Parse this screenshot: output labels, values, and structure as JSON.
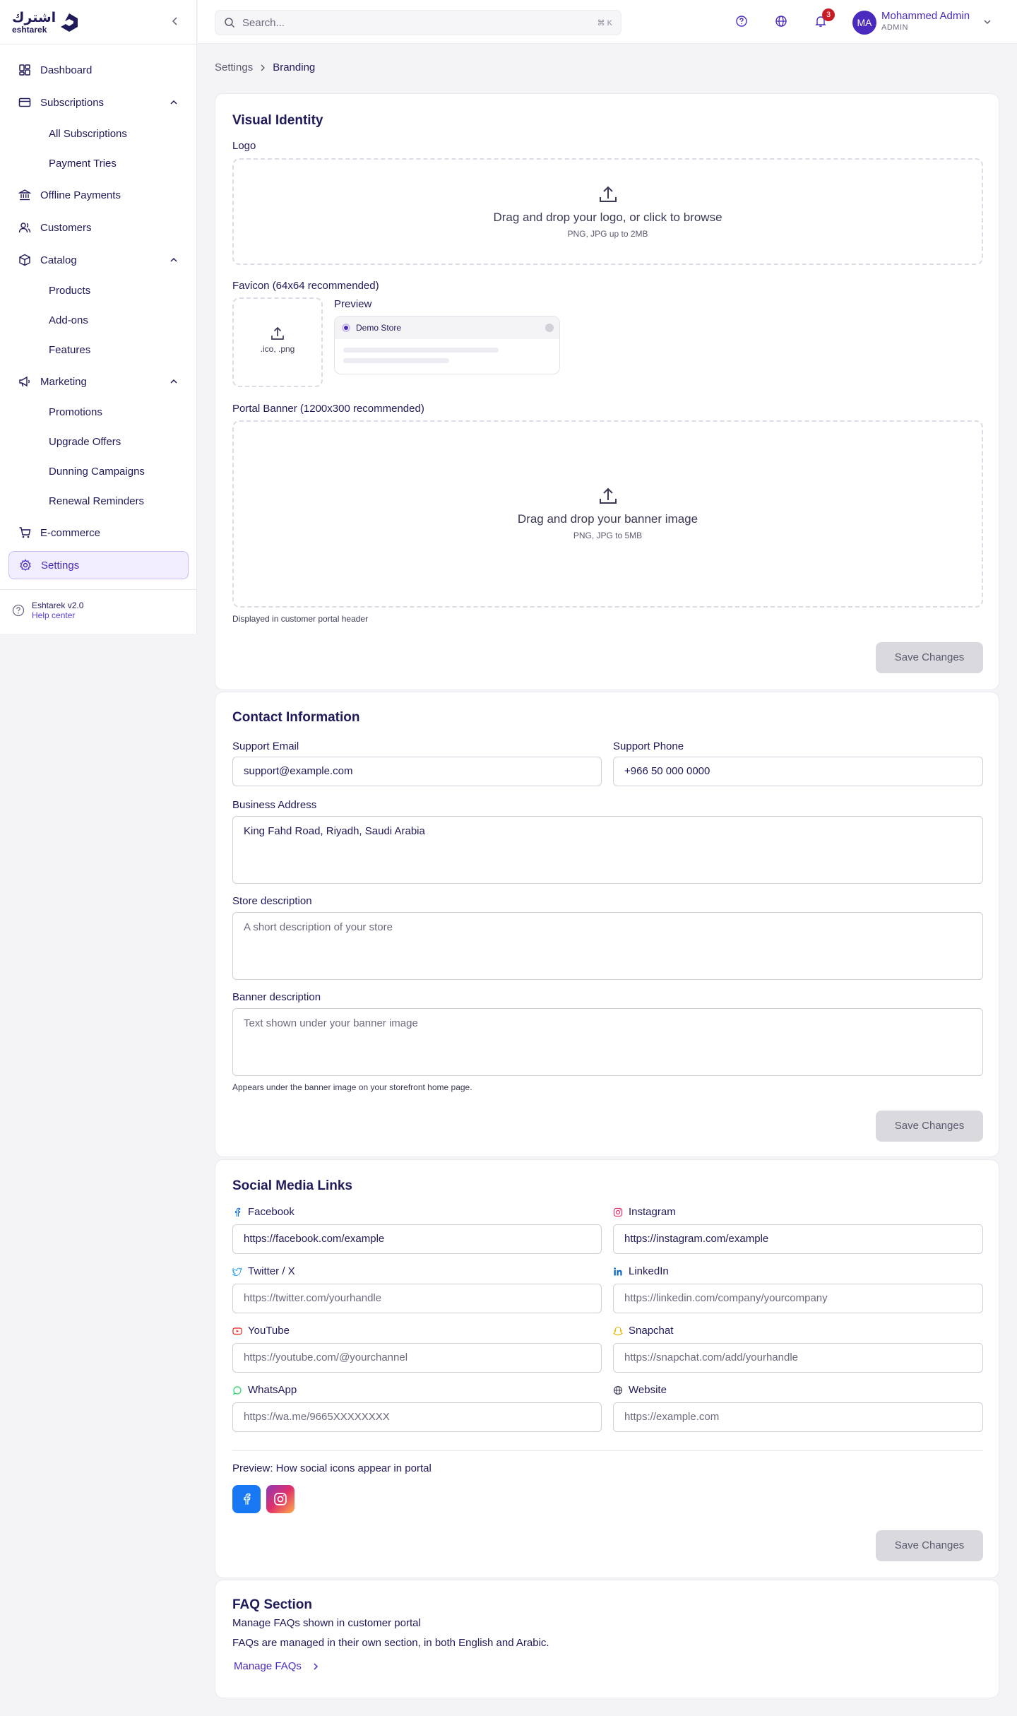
{
  "brand": {
    "name_ar": "اشترك",
    "name_en": "eshtarek"
  },
  "sidebar": {
    "items": [
      {
        "label": "Dashboard"
      },
      {
        "label": "Subscriptions"
      },
      {
        "label": "Offline Payments"
      },
      {
        "label": "Customers"
      },
      {
        "label": "Catalog"
      },
      {
        "label": "Marketing"
      },
      {
        "label": "E-commerce"
      },
      {
        "label": "Settings"
      }
    ],
    "subscriptions_sub": [
      "All Subscriptions",
      "Payment Tries"
    ],
    "catalog_sub": [
      "Products",
      "Add-ons",
      "Features"
    ],
    "marketing_sub": [
      "Promotions",
      "Upgrade Offers",
      "Dunning Campaigns",
      "Renewal Reminders"
    ],
    "footer": {
      "version": "Eshtarek v2.0",
      "help": "Help center"
    }
  },
  "topbar": {
    "search_placeholder": "Search...",
    "search_shortcut": "⌘ K",
    "notification_count": "3",
    "user": {
      "initials": "MA",
      "name": "Mohammed Admin",
      "role": "ADMIN"
    }
  },
  "breadcrumb": {
    "parent": "Settings",
    "current": "Branding"
  },
  "visual_identity": {
    "title": "Visual Identity",
    "logo_label": "Logo",
    "logo_drop": "Drag and drop your logo, or click to browse",
    "logo_hint": "PNG, JPG up to 2MB",
    "favicon_label": "Favicon (64x64 recommended)",
    "favicon_hint": ".ico, .png",
    "preview_label": "Preview",
    "preview_store": "Demo Store",
    "banner_label": "Portal Banner (1200x300 recommended)",
    "banner_drop": "Drag and drop your banner image",
    "banner_hint": "PNG, JPG to 5MB",
    "banner_note": "Displayed in customer portal header",
    "save": "Save Changes"
  },
  "contact": {
    "title": "Contact Information",
    "email_label": "Support Email",
    "email_value": "support@example.com",
    "phone_label": "Support Phone",
    "phone_value": "+966 50 000 0000",
    "address_label": "Business Address",
    "address_value": "King Fahd Road, Riyadh, Saudi Arabia",
    "store_desc_label": "Store description",
    "store_desc_placeholder": "A short description of your store",
    "banner_desc_label": "Banner description",
    "banner_desc_placeholder": "Text shown under your banner image",
    "banner_desc_hint": "Appears under the banner image on your storefront home page.",
    "save": "Save Changes"
  },
  "social": {
    "title": "Social Media Links",
    "facebook_label": "Facebook",
    "facebook_value": "https://facebook.com/example",
    "instagram_label": "Instagram",
    "instagram_value": "https://instagram.com/example",
    "twitter_label": "Twitter / X",
    "twitter_placeholder": "https://twitter.com/yourhandle",
    "linkedin_label": "LinkedIn",
    "linkedin_placeholder": "https://linkedin.com/company/yourcompany",
    "youtube_label": "YouTube",
    "youtube_placeholder": "https://youtube.com/@yourchannel",
    "snapchat_label": "Snapchat",
    "snapchat_placeholder": "https://snapchat.com/add/yourhandle",
    "whatsapp_label": "WhatsApp",
    "whatsapp_placeholder": "https://wa.me/9665XXXXXXXX",
    "website_label": "Website",
    "website_placeholder": "https://example.com",
    "preview_label": "Preview: How social icons appear in portal",
    "save": "Save Changes"
  },
  "faq": {
    "title": "FAQ Section",
    "subtitle": "Manage FAQs shown in customer portal",
    "note": "FAQs are managed in their own section, in both English and Arabic.",
    "link": "Manage FAQs"
  },
  "colors": {
    "accent": "#4b2bbd",
    "text": "#1f1a5a",
    "badge": "#c81d25"
  },
  "icons": [
    "dashboard-icon",
    "card-icon",
    "bank-icon",
    "users-icon",
    "box-icon",
    "megaphone-icon",
    "cart-icon",
    "gear-icon",
    "help-icon",
    "globe-icon",
    "bell-icon",
    "search-icon",
    "upload-icon"
  ]
}
